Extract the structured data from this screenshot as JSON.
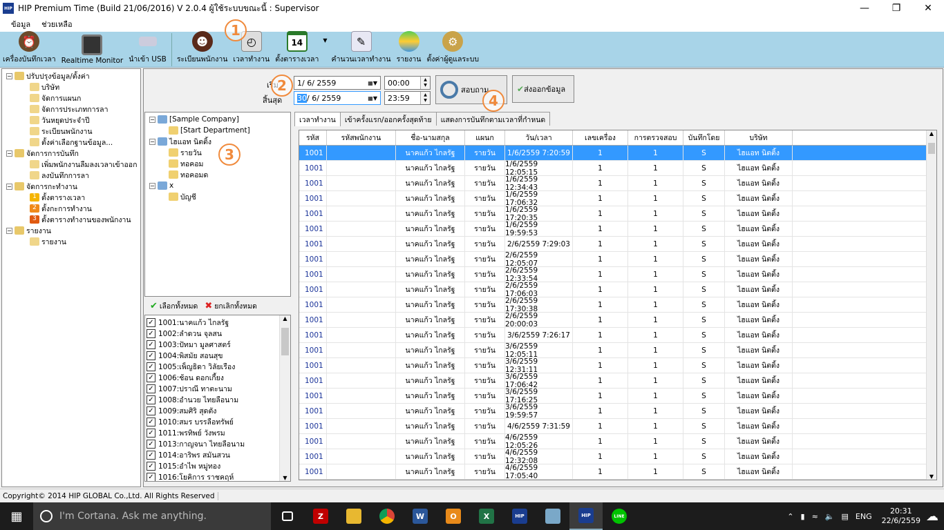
{
  "window": {
    "title": "HIP Premium Time (Build 21/06/2016) V 2.0.4   ผู้ใช้ระบบขณะนี้ : Supervisor",
    "app_icon": "HIP"
  },
  "menu": [
    "ข้อมูล",
    "ช่วยเหลือ"
  ],
  "toolbar": [
    {
      "label": "เครื่องบันทึกเวลา",
      "icon": "alarm-clock-icon"
    },
    {
      "label": "Realtime Monitor",
      "icon": "monitor-icon"
    },
    {
      "label": "นำเข้า USB",
      "icon": "usb-icon"
    },
    {
      "label": "ระเบียนพนักงาน",
      "icon": "employees-icon"
    },
    {
      "label": "เวลาทำงาน",
      "icon": "worktime-icon"
    },
    {
      "label": "ตั้งตารางเวลา",
      "icon": "calendar-icon",
      "icon_text": "14"
    },
    {
      "label": "คำนวนเวลาทำงาน",
      "icon": "calculate-icon"
    },
    {
      "label": "รายงาน",
      "icon": "report-icon"
    },
    {
      "label": "ตั้งค่าผู้ดูแลระบบ",
      "icon": "admin-settings-icon"
    }
  ],
  "left_tree": [
    {
      "label": "ปรับปรุงข้อมูล/ตั้งค่า",
      "level": 0,
      "expander": "−"
    },
    {
      "label": "บริษัท",
      "level": 1
    },
    {
      "label": "จัดการแผนก",
      "level": 1
    },
    {
      "label": "จัดการประเภทการลา",
      "level": 1
    },
    {
      "label": "วันหยุดประจำปี",
      "level": 1
    },
    {
      "label": "ระเบียนพนักงาน",
      "level": 1
    },
    {
      "label": "ตั้งค่าเลือกฐานข้อมูล...",
      "level": 1
    },
    {
      "label": "จัดการการบันทึก",
      "level": 0,
      "expander": "−"
    },
    {
      "label": "เพิ่มพนักงานลืมลงเวลาเข้าออก",
      "level": 1
    },
    {
      "label": "ลงบันทึกการลา",
      "level": 1
    },
    {
      "label": "จัดการกะทำงาน",
      "level": 0,
      "expander": "−"
    },
    {
      "label": "ตั้งตารางเวลา",
      "level": 1,
      "badge": "1"
    },
    {
      "label": "ตั้งกะการทำงาน",
      "level": 1,
      "badge": "2"
    },
    {
      "label": "ตั้งตารางทำงานของพนักงาน",
      "level": 1,
      "badge": "3"
    },
    {
      "label": "รายงาน",
      "level": 0,
      "expander": "−"
    },
    {
      "label": "รายงาน",
      "level": 1
    }
  ],
  "filter": {
    "start_label": "เริ่ม",
    "end_label": "สิ้นสุด",
    "start_date": "1/  6/  2559",
    "end_date_sel": "30",
    "end_date_rest": "/  6/  2559",
    "start_time": "00:00",
    "end_time": "23:59",
    "search_label": "สอบถาม",
    "export_label": "ส่งออกข้อมูล"
  },
  "callouts": [
    "1",
    "2",
    "3",
    "4"
  ],
  "org_tree": [
    {
      "label": "[Sample Company]",
      "level": 0,
      "expander": "−"
    },
    {
      "label": "[Start Department]",
      "level": 1
    },
    {
      "label": "ไฮแอท นิตติ้ง",
      "level": 0,
      "expander": "−"
    },
    {
      "label": "รายวัน",
      "level": 1
    },
    {
      "label": "ทอคอม",
      "level": 1
    },
    {
      "label": "ทอคอมด",
      "level": 1
    },
    {
      "label": "x",
      "level": 0,
      "expander": "−"
    },
    {
      "label": "บัญชี",
      "level": 1
    }
  ],
  "select_all": "เลือกทั้งหมด",
  "deselect_all": "ยกเลิกทั้งหมด",
  "employees": [
    "1001:นาคแก้ว  ไกลรัฐ",
    "1002:ลำดวน  จุลสน",
    "1003:ปัทมา  มูลศาสตร์",
    "1004:พิสมัย  สอนสุข",
    "1005:เพ็ญธิดา  วิลัยเรือง",
    "1006:ช้อน ดอกเกี้ยง",
    "1007:ปราณี  ทาตะนาม",
    "1008:อำนวย  ไทยลือนาม",
    "1009:สมศิริ  สุดตัง",
    "1010:สมร  บรรลือทรัพย์",
    "1011:พรทิพย์  วังพรม",
    "1013:กาญจนา ไทยลือนาม",
    "1014:อาริพร  สมันสวน",
    "1015:อำไพ  หมู่ทอง",
    "1016:โยคิการ ราชคฤห์"
  ],
  "tabs": [
    "เวลาทำงาน",
    "เข้าครั้งแรก/ออกครั้งสุดท้าย",
    "แสดงการบันทึกตามเวลาที่กำหนด"
  ],
  "columns": [
    "รหัส",
    "รหัสพนักงาน",
    "ชื่อ-นามสกุล",
    "แผนก",
    "วัน/เวลา",
    "เลขเครื่อง",
    "การตรวจสอบ",
    "บันทึกโดย",
    "บริษัท"
  ],
  "rows": [
    [
      "1001",
      "",
      "นาคแก้ว  ไกลรัฐ",
      "รายวัน",
      "1/6/2559 7:20:59",
      "1",
      "1",
      "S",
      "ไฮแอท นิตติ้ง"
    ],
    [
      "1001",
      "",
      "นาคแก้ว  ไกลรัฐ",
      "รายวัน",
      "1/6/2559 12:05:15",
      "1",
      "1",
      "S",
      "ไฮแอท นิตติ้ง"
    ],
    [
      "1001",
      "",
      "นาคแก้ว  ไกลรัฐ",
      "รายวัน",
      "1/6/2559 12:34:43",
      "1",
      "1",
      "S",
      "ไฮแอท นิตติ้ง"
    ],
    [
      "1001",
      "",
      "นาคแก้ว  ไกลรัฐ",
      "รายวัน",
      "1/6/2559 17:06:32",
      "1",
      "1",
      "S",
      "ไฮแอท นิตติ้ง"
    ],
    [
      "1001",
      "",
      "นาคแก้ว  ไกลรัฐ",
      "รายวัน",
      "1/6/2559 17:20:35",
      "1",
      "1",
      "S",
      "ไฮแอท นิตติ้ง"
    ],
    [
      "1001",
      "",
      "นาคแก้ว  ไกลรัฐ",
      "รายวัน",
      "1/6/2559 19:59:53",
      "1",
      "1",
      "S",
      "ไฮแอท นิตติ้ง"
    ],
    [
      "1001",
      "",
      "นาคแก้ว  ไกลรัฐ",
      "รายวัน",
      "2/6/2559 7:29:03",
      "1",
      "1",
      "S",
      "ไฮแอท นิตติ้ง"
    ],
    [
      "1001",
      "",
      "นาคแก้ว  ไกลรัฐ",
      "รายวัน",
      "2/6/2559 12:05:07",
      "1",
      "1",
      "S",
      "ไฮแอท นิตติ้ง"
    ],
    [
      "1001",
      "",
      "นาคแก้ว  ไกลรัฐ",
      "รายวัน",
      "2/6/2559 12:33:54",
      "1",
      "1",
      "S",
      "ไฮแอท นิตติ้ง"
    ],
    [
      "1001",
      "",
      "นาคแก้ว  ไกลรัฐ",
      "รายวัน",
      "2/6/2559 17:06:03",
      "1",
      "1",
      "S",
      "ไฮแอท นิตติ้ง"
    ],
    [
      "1001",
      "",
      "นาคแก้ว  ไกลรัฐ",
      "รายวัน",
      "2/6/2559 17:30:38",
      "1",
      "1",
      "S",
      "ไฮแอท นิตติ้ง"
    ],
    [
      "1001",
      "",
      "นาคแก้ว  ไกลรัฐ",
      "รายวัน",
      "2/6/2559 20:00:03",
      "1",
      "1",
      "S",
      "ไฮแอท นิตติ้ง"
    ],
    [
      "1001",
      "",
      "นาคแก้ว  ไกลรัฐ",
      "รายวัน",
      "3/6/2559 7:26:17",
      "1",
      "1",
      "S",
      "ไฮแอท นิตติ้ง"
    ],
    [
      "1001",
      "",
      "นาคแก้ว  ไกลรัฐ",
      "รายวัน",
      "3/6/2559 12:05:11",
      "1",
      "1",
      "S",
      "ไฮแอท นิตติ้ง"
    ],
    [
      "1001",
      "",
      "นาคแก้ว  ไกลรัฐ",
      "รายวัน",
      "3/6/2559 12:31:11",
      "1",
      "1",
      "S",
      "ไฮแอท นิตติ้ง"
    ],
    [
      "1001",
      "",
      "นาคแก้ว  ไกลรัฐ",
      "รายวัน",
      "3/6/2559 17:06:42",
      "1",
      "1",
      "S",
      "ไฮแอท นิตติ้ง"
    ],
    [
      "1001",
      "",
      "นาคแก้ว  ไกลรัฐ",
      "รายวัน",
      "3/6/2559 17:16:25",
      "1",
      "1",
      "S",
      "ไฮแอท นิตติ้ง"
    ],
    [
      "1001",
      "",
      "นาคแก้ว  ไกลรัฐ",
      "รายวัน",
      "3/6/2559 19:59:57",
      "1",
      "1",
      "S",
      "ไฮแอท นิตติ้ง"
    ],
    [
      "1001",
      "",
      "นาคแก้ว  ไกลรัฐ",
      "รายวัน",
      "4/6/2559 7:31:59",
      "1",
      "1",
      "S",
      "ไฮแอท นิตติ้ง"
    ],
    [
      "1001",
      "",
      "นาคแก้ว  ไกลรัฐ",
      "รายวัน",
      "4/6/2559 12:05:26",
      "1",
      "1",
      "S",
      "ไฮแอท นิตติ้ง"
    ],
    [
      "1001",
      "",
      "นาคแก้ว  ไกลรัฐ",
      "รายวัน",
      "4/6/2559 12:32:08",
      "1",
      "1",
      "S",
      "ไฮแอท นิตติ้ง"
    ],
    [
      "1001",
      "",
      "นาคแก้ว  ไกลรัฐ",
      "รายวัน",
      "4/6/2559 17:05:40",
      "1",
      "1",
      "S",
      "ไฮแอท นิตติ้ง"
    ]
  ],
  "status": "Copyright© 2014 HIP GLOBAL Co.,Ltd. All Rights Reserved",
  "taskbar": {
    "cortana": "I'm Cortana. Ask me anything.",
    "lang": "ENG",
    "time": "20:31",
    "date": "22/6/2559"
  },
  "colors": {
    "toolbar": "#a8d4e8",
    "selection": "#3399ff",
    "callout": "#f08a3c",
    "taskbar": "#1c1c1c"
  }
}
